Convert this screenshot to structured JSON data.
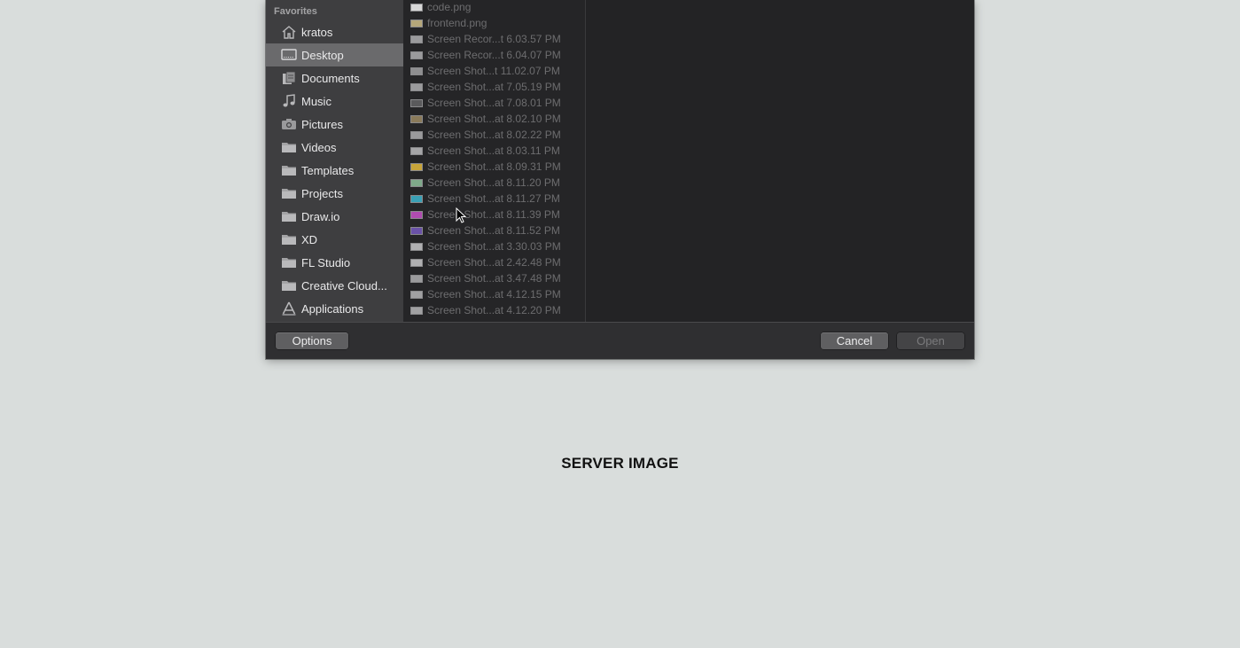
{
  "dialog": {
    "sidebar": {
      "header": "Favorites",
      "items": [
        {
          "label": "kratos",
          "icon": "home-icon",
          "selected": false
        },
        {
          "label": "Desktop",
          "icon": "desktop-icon",
          "selected": true
        },
        {
          "label": "Documents",
          "icon": "documents-icon",
          "selected": false
        },
        {
          "label": "Music",
          "icon": "music-note-icon",
          "selected": false
        },
        {
          "label": "Pictures",
          "icon": "camera-icon",
          "selected": false
        },
        {
          "label": "Videos",
          "icon": "folder-icon",
          "selected": false
        },
        {
          "label": "Templates",
          "icon": "folder-icon",
          "selected": false
        },
        {
          "label": "Projects",
          "icon": "folder-icon",
          "selected": false
        },
        {
          "label": "Draw.io",
          "icon": "folder-icon",
          "selected": false
        },
        {
          "label": "XD",
          "icon": "folder-icon",
          "selected": false
        },
        {
          "label": "FL Studio",
          "icon": "folder-icon",
          "selected": false
        },
        {
          "label": "Creative Cloud...",
          "icon": "folder-icon",
          "selected": false
        },
        {
          "label": "Applications",
          "icon": "applications-icon",
          "selected": false
        }
      ]
    },
    "files": [
      {
        "name": "code.png",
        "thumb_color": "#d8d8d8"
      },
      {
        "name": "frontend.png",
        "thumb_color": "#b5a77a"
      },
      {
        "name": "Screen Recor...t 6.03.57 PM",
        "thumb_color": "#9a9a9c"
      },
      {
        "name": "Screen Recor...t 6.04.07 PM",
        "thumb_color": "#9a9a9c"
      },
      {
        "name": "Screen Shot...t 11.02.07 PM",
        "thumb_color": "#8e8e90"
      },
      {
        "name": "Screen Shot...at 7.05.19 PM",
        "thumb_color": "#9a9a9c"
      },
      {
        "name": "Screen Shot...at 7.08.01 PM",
        "thumb_color": "#5a5a5c"
      },
      {
        "name": "Screen Shot...at 8.02.10 PM",
        "thumb_color": "#8a7a5a"
      },
      {
        "name": "Screen Shot...at 8.02.22 PM",
        "thumb_color": "#9a9a9c"
      },
      {
        "name": "Screen Shot...at 8.03.11 PM",
        "thumb_color": "#a5a5a7"
      },
      {
        "name": "Screen Shot...at 8.09.31 PM",
        "thumb_color": "#c7a43a"
      },
      {
        "name": "Screen Shot...at 8.11.20 PM",
        "thumb_color": "#7fa98a"
      },
      {
        "name": "Screen Shot...at 8.11.27 PM",
        "thumb_color": "#3aa0b5"
      },
      {
        "name": "Screen Shot...at 8.11.39 PM",
        "thumb_color": "#b04cb0"
      },
      {
        "name": "Screen Shot...at 8.11.52 PM",
        "thumb_color": "#6a52a8"
      },
      {
        "name": "Screen Shot...at 3.30.03 PM",
        "thumb_color": "#b0b0b2"
      },
      {
        "name": "Screen Shot...at 2.42.48 PM",
        "thumb_color": "#b0b0b2"
      },
      {
        "name": "Screen Shot...at 3.47.48 PM",
        "thumb_color": "#9a9a9c"
      },
      {
        "name": "Screen Shot...at 4.12.15 PM",
        "thumb_color": "#a0a0a2"
      },
      {
        "name": "Screen Shot...at 4.12.20 PM",
        "thumb_color": "#a0a0a2"
      }
    ],
    "footer": {
      "options_label": "Options",
      "cancel_label": "Cancel",
      "open_label": "Open"
    }
  },
  "page": {
    "title": "SERVER IMAGE"
  }
}
